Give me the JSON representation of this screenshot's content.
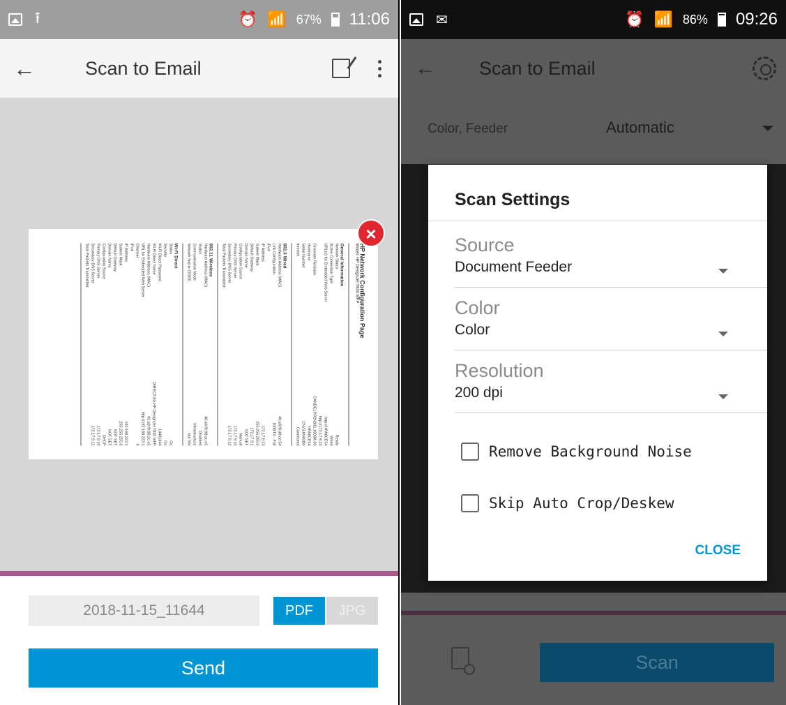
{
  "left": {
    "status": {
      "battery": "67%",
      "time": "11:06",
      "battery_level": 0.67
    },
    "appbar": {
      "back": "←",
      "title": "Scan to Email"
    },
    "document": {
      "title": "HP Network Configuration Page",
      "model": "Model: HP DesignJet T830 MFP",
      "sections": [
        {
          "heading": "General Information",
          "rows": [
            [
              "Network Status",
              "Ready"
            ],
            [
              "Active Connection Type",
              "Wired"
            ],
            [
              "URL(s) for Embedded Web Server",
              "http://HPA8CE54"
            ],
            [
              "",
              "http://172.17.9.23"
            ],
            [
              "Firmware Revision",
              "CANDELPR2N001.1808A.00"
            ],
            [
              "Hostname",
              "HPA8CE54"
            ],
            [
              "Serial Number",
              "CN73JAM0D0"
            ],
            [
              "Internet",
              "Connected"
            ]
          ]
        },
        {
          "heading": "802.3 Wired",
          "rows": [
            [
              "Hardware Address (MAC)",
              "40:a8:f0:a8:ce:54"
            ],
            [
              "Link Configuration",
              "100BTX - Full"
            ],
            [
              "IPv4",
              ""
            ],
            [
              "IP Address",
              "172.17.9.23"
            ],
            [
              "Subnet Mask",
              "255.255.255.0"
            ],
            [
              "Default Gateway",
              "172.17.9.1"
            ],
            [
              "Domain Name",
              "NOT SET"
            ],
            [
              "Configuration Source",
              "Manual"
            ],
            [
              "Primary DNS Server",
              "172.17.9.10"
            ],
            [
              "Secondary DNS Server",
              "172.17.9.12"
            ],
            [
              "Total Packets Transmitted",
              ""
            ]
          ]
        },
        {
          "heading": "802.11 Wireless",
          "rows": [
            [
              "Hardware Address (MAC)",
              "40:a8:f0:98:ac:e5"
            ],
            [
              "Status",
              "Disabled"
            ],
            [
              "Communication Mode",
              "Infrastructure"
            ],
            [
              "Network Name (SSID)",
              "Not Set"
            ]
          ]
        },
        {
          "heading": "Wi-Fi Direct",
          "rows": [
            [
              "Status",
              "On"
            ],
            [
              "Security",
              "On"
            ],
            [
              "Wi-Fi Direct Password",
              "14401444"
            ],
            [
              "Wi-Fi Direct Name",
              "DIRECT-E5-HP DesignJet T830 MFP"
            ],
            [
              "Hardware Address (MAC)",
              "42:a8:f0:98:2c:e5"
            ],
            [
              "URL for Embedded Web Server",
              "http://192.168.223.1"
            ],
            [
              "Channel",
              "6"
            ],
            [
              "IPv4",
              ""
            ],
            [
              "IP Address",
              "192.168.223.1"
            ],
            [
              "Subnet Mask",
              "255.255.255.0"
            ],
            [
              "Default Gateway",
              "NOT SET"
            ],
            [
              "Domain Name",
              "NOT SET"
            ],
            [
              "Configuration Source",
              "DHCP"
            ],
            [
              "Primary DNS Server",
              "172.17.9.10"
            ],
            [
              "Secondary DNS Server",
              "172.17.9.12"
            ],
            [
              "Total Packets Transmitted",
              ""
            ]
          ]
        }
      ]
    },
    "remove_icon": "×",
    "filename": "2018-11-15_11644",
    "formats": {
      "pdf": "PDF",
      "jpg": "JPG",
      "selected": "PDF"
    },
    "send_label": "Send",
    "colors": {
      "accent": "#0096d6",
      "divider": "#a85b8c",
      "remove": "#e0262f"
    }
  },
  "right": {
    "status": {
      "battery": "86%",
      "time": "09:26",
      "battery_level": 0.86
    },
    "appbar": {
      "back": "←",
      "title": "Scan to Email"
    },
    "summary": "Color, Feeder",
    "mode": "Automatic",
    "dialog": {
      "title": "Scan Settings",
      "fields": [
        {
          "label": "Source",
          "value": "Document Feeder"
        },
        {
          "label": "Color",
          "value": "Color"
        },
        {
          "label": "Resolution",
          "value": "200 dpi"
        }
      ],
      "checkboxes": [
        {
          "label": "Remove Background Noise",
          "checked": false
        },
        {
          "label": "Skip Auto Crop/Deskew",
          "checked": false
        }
      ],
      "close_label": "CLOSE"
    },
    "scan_label": "Scan"
  }
}
